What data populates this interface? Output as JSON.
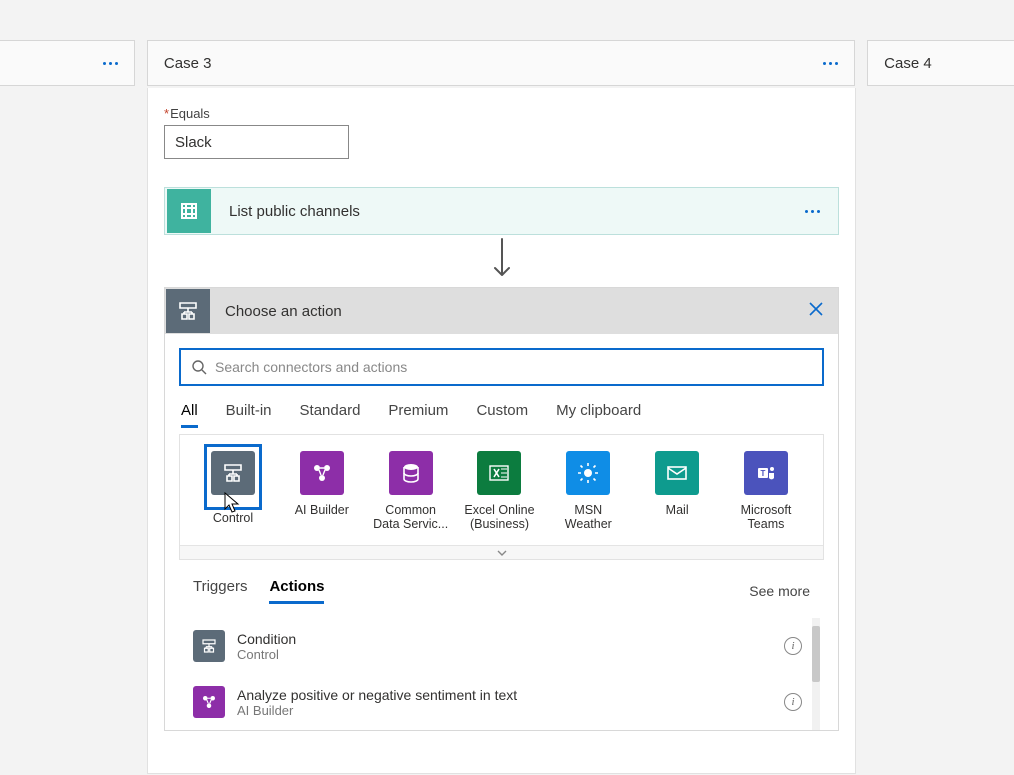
{
  "cases": {
    "prev_label": "",
    "main_label": "Case 3",
    "next_label": "Case 4"
  },
  "equals": {
    "label": "Equals",
    "value": "Slack"
  },
  "existing_action": {
    "title": "List public channels"
  },
  "chooser": {
    "title": "Choose an action",
    "search_placeholder": "Search connectors and actions"
  },
  "tabs": [
    "All",
    "Built-in",
    "Standard",
    "Premium",
    "Custom",
    "My clipboard"
  ],
  "connectors": [
    {
      "name": "Control",
      "color": "#5c6b78",
      "icon": "control"
    },
    {
      "name": "AI Builder",
      "color": "#8d2ea8",
      "icon": "aibuilder"
    },
    {
      "name": "Common Data Servic...",
      "color": "#8d2ea8",
      "icon": "cds"
    },
    {
      "name": "Excel Online (Business)",
      "color": "#0c7c3f",
      "icon": "excel"
    },
    {
      "name": "MSN Weather",
      "color": "#0f8de6",
      "icon": "weather"
    },
    {
      "name": "Mail",
      "color": "#0e9b8e",
      "icon": "mail"
    },
    {
      "name": "Microsoft Teams",
      "color": "#4b53bc",
      "icon": "teams"
    }
  ],
  "ta_tabs": {
    "triggers": "Triggers",
    "actions": "Actions",
    "see_more": "See more"
  },
  "action_list": [
    {
      "title": "Condition",
      "sub": "Control",
      "color": "#5c6b78",
      "icon": "control"
    },
    {
      "title": "Analyze positive or negative sentiment in text",
      "sub": "AI Builder",
      "color": "#8d2ea8",
      "icon": "aibuilder"
    }
  ]
}
